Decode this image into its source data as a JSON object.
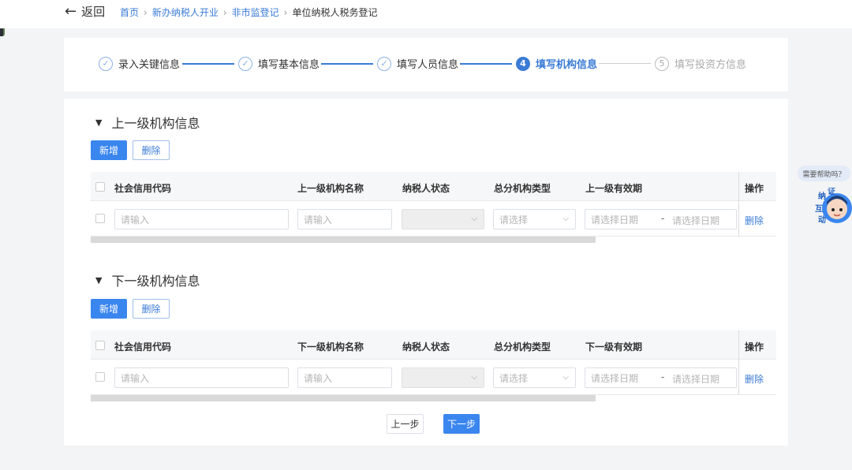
{
  "header": {
    "back_label": "返回",
    "breadcrumb": [
      "首页",
      "新办纳税人开业",
      "非市监登记",
      "单位纳税人税务登记"
    ]
  },
  "steps": [
    {
      "num": "✓",
      "label": "录入关键信息",
      "state": "done"
    },
    {
      "num": "✓",
      "label": "填写基本信息",
      "state": "done"
    },
    {
      "num": "✓",
      "label": "填写人员信息",
      "state": "done"
    },
    {
      "num": "4",
      "label": "填写机构信息",
      "state": "active"
    },
    {
      "num": "5",
      "label": "填写投资方信息",
      "state": "todo"
    }
  ],
  "sections": [
    {
      "title": "上一级机构信息",
      "add_label": "新增",
      "delete_label": "删除",
      "columns": [
        "社会信用代码",
        "上一级机构名称",
        "纳税人状态",
        "总分机构类型",
        "上一级有效期",
        "操作"
      ],
      "row": {
        "credit_code_placeholder": "请输入",
        "org_name_placeholder": "请输入",
        "status_value": "",
        "type_placeholder": "请选择",
        "start_date_placeholder": "请选择日期",
        "range_sep": "-",
        "end_date_placeholder": "请选择日期",
        "action_label": "删除"
      }
    },
    {
      "title": "下一级机构信息",
      "add_label": "新增",
      "delete_label": "删除",
      "columns": [
        "社会信用代码",
        "下一级机构名称",
        "纳税人状态",
        "总分机构类型",
        "下一级有效期",
        "操作"
      ],
      "row": {
        "credit_code_placeholder": "请输入",
        "org_name_placeholder": "请输入",
        "status_value": "",
        "type_placeholder": "请选择",
        "start_date_placeholder": "请选择日期",
        "range_sep": "-",
        "end_date_placeholder": "请选择日期",
        "action_label": "删除"
      }
    }
  ],
  "footer": {
    "prev_label": "上一步",
    "next_label": "下一步"
  },
  "assistant": {
    "bubble_text": "需要帮助吗？",
    "badge_chars": [
      "纳",
      "证",
      "互",
      "动"
    ]
  },
  "colors": {
    "accent": "#3a86ef",
    "link": "#3a7bd5"
  }
}
